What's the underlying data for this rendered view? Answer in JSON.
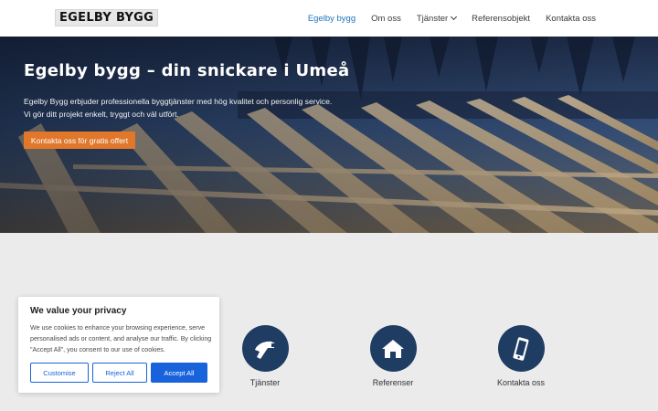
{
  "header": {
    "logo_text": "EGELBY BYGG",
    "nav": [
      {
        "label": "Egelby bygg",
        "active": true
      },
      {
        "label": "Om oss"
      },
      {
        "label": "Tjänster",
        "has_dropdown": true
      },
      {
        "label": "Referensobjekt"
      },
      {
        "label": "Kontakta oss"
      }
    ]
  },
  "hero": {
    "title": "Egelby bygg – din snickare i Umeå",
    "text_line1": "Egelby Bygg erbjuder professionella byggtjänster med hög kvalitet och personlig service.",
    "text_line2": "Vi gör ditt projekt enkelt, tryggt och väl utfört.",
    "cta_label": "Kontakta oss för gratis offert"
  },
  "services": [
    {
      "label": "Tjänster",
      "icon": "hammer-drill-icon"
    },
    {
      "label": "Referenser",
      "icon": "house-icon"
    },
    {
      "label": "Kontakta oss",
      "icon": "phone-icon"
    }
  ],
  "cookie_banner": {
    "title": "We value your privacy",
    "text": "We use cookies to enhance your browsing experience, serve personalised ads or content, and analyse our traffic. By clicking \"Accept All\", you consent to our use of cookies.",
    "customise_label": "Customise",
    "reject_label": "Reject All",
    "accept_label": "Accept All"
  },
  "colors": {
    "nav_active": "#1e73be",
    "cta": "#e0772a",
    "icon_circle": "#1f3c63",
    "cookie_accent": "#1863dc"
  }
}
